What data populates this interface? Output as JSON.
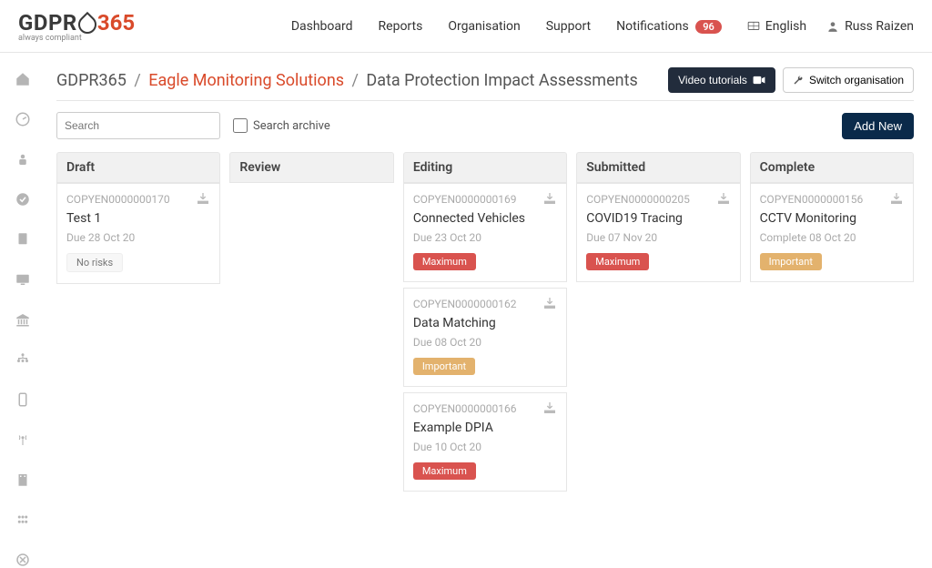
{
  "header": {
    "logo_text": "GDPR",
    "logo_num": "365",
    "logo_tag": "always compliant",
    "nav": [
      "Dashboard",
      "Reports",
      "Organisation",
      "Support",
      "Notifications"
    ],
    "notif_count": "96",
    "language": "English",
    "user": "Russ Raizen"
  },
  "breadcrumb": {
    "root": "GDPR365",
    "org": "Eagle Monitoring Solutions",
    "page": "Data Protection Impact Assessments"
  },
  "actions": {
    "video": "Video tutorials",
    "switch_org": "Switch organisation"
  },
  "toolbar": {
    "search_placeholder": "Search",
    "archive_label": "Search archive",
    "add_new": "Add New"
  },
  "columns": [
    {
      "title": "Draft"
    },
    {
      "title": "Review"
    },
    {
      "title": "Editing"
    },
    {
      "title": "Submitted"
    },
    {
      "title": "Complete"
    }
  ],
  "cards": {
    "draft": [
      {
        "ref": "COPYEN0000000170",
        "title": "Test 1",
        "due": "Due 28 Oct 20",
        "risk": "No risks",
        "risk_class": "risk-none"
      }
    ],
    "editing": [
      {
        "ref": "COPYEN0000000169",
        "title": "Connected Vehicles",
        "due": "Due 23 Oct 20",
        "risk": "Maximum",
        "risk_class": "risk-max"
      },
      {
        "ref": "COPYEN0000000162",
        "title": "Data Matching",
        "due": "Due 08 Oct 20",
        "risk": "Important",
        "risk_class": "risk-important"
      },
      {
        "ref": "COPYEN0000000166",
        "title": "Example DPIA",
        "due": "Due 10 Oct 20",
        "risk": "Maximum",
        "risk_class": "risk-max"
      }
    ],
    "submitted": [
      {
        "ref": "COPYEN0000000205",
        "title": "COVID19 Tracing",
        "due": "Due 07 Nov 20",
        "risk": "Maximum",
        "risk_class": "risk-max"
      }
    ],
    "complete": [
      {
        "ref": "COPYEN0000000156",
        "title": "CCTV Monitoring",
        "due": "Complete 08 Oct 20",
        "risk": "Important",
        "risk_class": "risk-important"
      }
    ]
  }
}
